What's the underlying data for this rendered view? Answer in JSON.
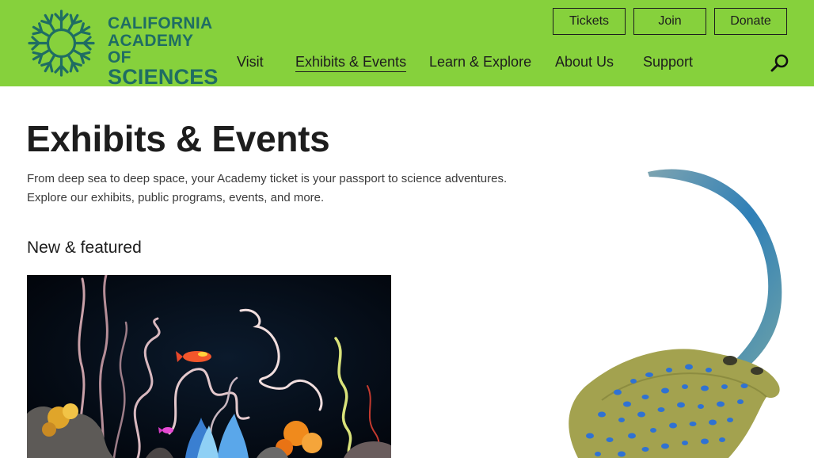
{
  "header": {
    "logo": {
      "line1": "CALIFORNIA",
      "line2": "ACADEMY OF",
      "line3": "SCIENCES",
      "icon": "sun-logo-mark",
      "color": "#1f6d63"
    },
    "background_color": "#86d13c",
    "utility_buttons": {
      "tickets": "Tickets",
      "join": "Join",
      "donate": "Donate"
    },
    "nav": {
      "visit": "Visit",
      "exhibits": "Exhibits & Events",
      "learn": "Learn & Explore",
      "about": "About Us",
      "support": "Support",
      "active": "Exhibits & Events"
    },
    "search_icon": "search-icon"
  },
  "main": {
    "title": "Exhibits & Events",
    "intro_line1": "From deep sea to deep space, your Academy ticket is your passport to science adventures.",
    "intro_line2": "Explore our exhibits, public programs, events, and more.",
    "section_title": "New & featured",
    "feature_image": "coral-reef-aquarium-image",
    "side_image": "blue-spotted-stingray-image"
  }
}
